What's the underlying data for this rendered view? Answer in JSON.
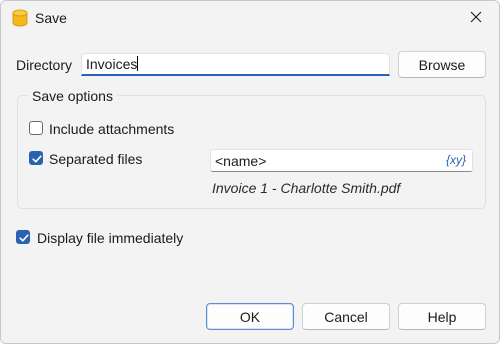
{
  "window": {
    "title": "Save"
  },
  "directory": {
    "label": "Directory",
    "value": "Invoices",
    "browse_label": "Browse"
  },
  "save_options": {
    "group_label": "Save options",
    "include_attachments": {
      "label": "Include attachments",
      "checked": false
    },
    "separated_files": {
      "label": "Separated files",
      "checked": true
    },
    "filename_pattern": "<name>",
    "variables_button": "{xy}",
    "preview": "Invoice 1 - Charlotte Smith.pdf"
  },
  "display_immediately": {
    "label": "Display file immediately",
    "checked": true
  },
  "buttons": {
    "ok": "OK",
    "cancel": "Cancel",
    "help": "Help"
  },
  "colors": {
    "accent": "#2a62b2",
    "app_icon": "#f2b81c"
  }
}
